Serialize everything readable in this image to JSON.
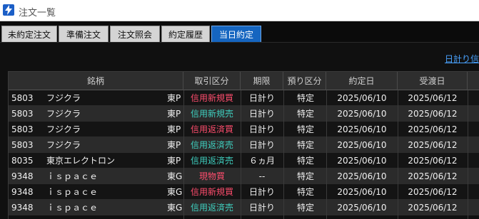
{
  "window": {
    "title": "注文一覧",
    "icon": "lightning-icon"
  },
  "tabs": [
    {
      "label": "未約定注文",
      "active": false
    },
    {
      "label": "準備注文",
      "active": false
    },
    {
      "label": "注文照会",
      "active": false
    },
    {
      "label": "約定履歴",
      "active": false
    },
    {
      "label": "当日約定",
      "active": true
    }
  ],
  "print_link": "日計り信",
  "table": {
    "headers": [
      "銘柄",
      "取引区分",
      "期限",
      "預り区分",
      "約定日",
      "受渡日"
    ],
    "rows": [
      {
        "code": "5803",
        "name": "フジクラ",
        "market": "東P",
        "trade_type": "信用新規買",
        "type_color": "#ff4d6d",
        "limit": "日計り",
        "account": "特定",
        "exec_date": "2025/06/10",
        "settle_date": "2025/06/12"
      },
      {
        "code": "5803",
        "name": "フジクラ",
        "market": "東P",
        "trade_type": "信用新規売",
        "type_color": "#3fd0c0",
        "limit": "日計り",
        "account": "特定",
        "exec_date": "2025/06/10",
        "settle_date": "2025/06/12"
      },
      {
        "code": "5803",
        "name": "フジクラ",
        "market": "東P",
        "trade_type": "信用返済買",
        "type_color": "#ff4d6d",
        "limit": "日計り",
        "account": "特定",
        "exec_date": "2025/06/10",
        "settle_date": "2025/06/12"
      },
      {
        "code": "5803",
        "name": "フジクラ",
        "market": "東P",
        "trade_type": "信用返済売",
        "type_color": "#3fd0c0",
        "limit": "日計り",
        "account": "特定",
        "exec_date": "2025/06/10",
        "settle_date": "2025/06/12"
      },
      {
        "code": "8035",
        "name": "東京エレクトロン",
        "market": "東P",
        "trade_type": "信用返済売",
        "type_color": "#3fd0c0",
        "limit": "６ヵ月",
        "account": "特定",
        "exec_date": "2025/06/10",
        "settle_date": "2025/06/12"
      },
      {
        "code": "9348",
        "name": "ｉｓｐａｃｅ",
        "market": "東G",
        "trade_type": "現物買",
        "type_color": "#ff4d6d",
        "limit": "--",
        "account": "特定",
        "exec_date": "2025/06/10",
        "settle_date": "2025/06/12"
      },
      {
        "code": "9348",
        "name": "ｉｓｐａｃｅ",
        "market": "東G",
        "trade_type": "信用新規買",
        "type_color": "#ff4d6d",
        "limit": "日計り",
        "account": "特定",
        "exec_date": "2025/06/10",
        "settle_date": "2025/06/12"
      },
      {
        "code": "9348",
        "name": "ｉｓｐａｃｅ",
        "market": "東G",
        "trade_type": "信用返済売",
        "type_color": "#3fd0c0",
        "limit": "日計り",
        "account": "特定",
        "exec_date": "2025/06/10",
        "settle_date": "2025/06/12"
      }
    ]
  }
}
